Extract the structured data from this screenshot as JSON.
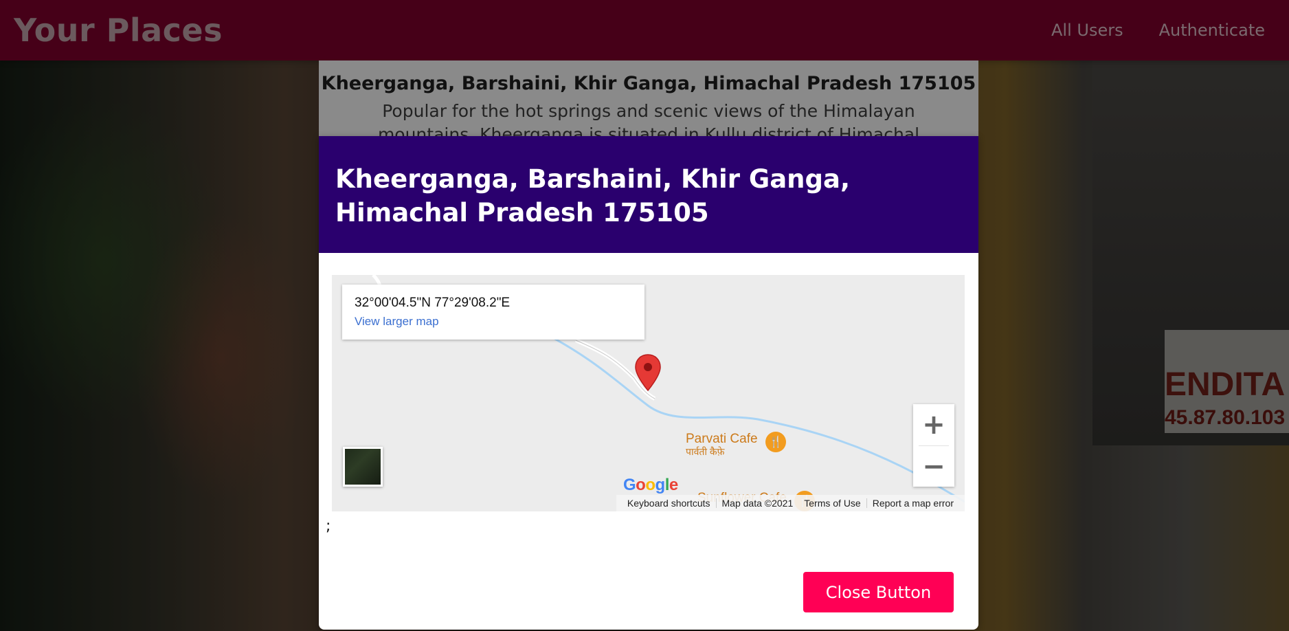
{
  "header": {
    "brand": "Your Places",
    "nav": [
      {
        "label": "All Users"
      },
      {
        "label": "Authenticate"
      }
    ]
  },
  "place_card": {
    "title": "Kheerganga, Barshaini, Khir Ganga, Himachal Pradesh 175105",
    "description": "Popular for the hot springs and scenic views of the Himalayan mountains, Kheerganga is situated in Kullu district of Himachal Pradesh, located about"
  },
  "modal": {
    "title": "Kheerganga, Barshaini, Khir Ganga, Himachal Pradesh 175105",
    "footer_text": ";",
    "close_label": "Close Button"
  },
  "map": {
    "coordinates": "32°00'04.5\"N 77°29'08.2\"E",
    "view_larger": "View larger map",
    "pois": [
      {
        "name": "Parvati Cafe",
        "subname": "पार्वती कैफ़े"
      },
      {
        "name": "Sunflower Cafe"
      }
    ],
    "zoom_in": "+",
    "zoom_out": "−",
    "logo": "Google",
    "footer": {
      "shortcuts": "Keyboard shortcuts",
      "map_data": "Map data ©2021",
      "terms": "Terms of Use",
      "report": "Report a map error"
    }
  },
  "colors": {
    "header_bg": "#460018",
    "modal_header_bg": "#2a006e",
    "button_bg": "#ff0055",
    "pin": "#e53935"
  }
}
